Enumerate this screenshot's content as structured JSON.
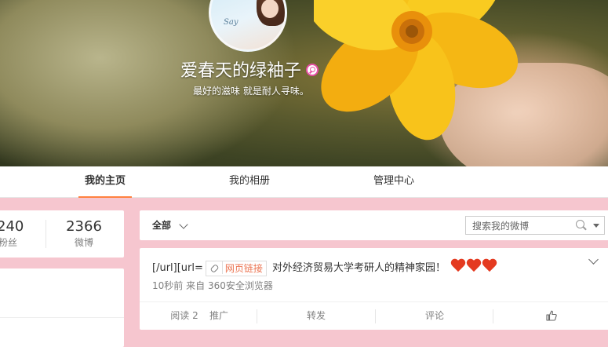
{
  "profile": {
    "nickname": "爱春天的绿袖子",
    "motto": "最好的滋味 就是耐人寻味。",
    "avatar_text": "Say"
  },
  "tabs": [
    {
      "label": "我的主页",
      "active": true
    },
    {
      "label": "我的相册",
      "active": false
    },
    {
      "label": "管理中心",
      "active": false
    }
  ],
  "counts": {
    "fans_num": "240",
    "fans_label": "粉丝",
    "posts_num": "2366",
    "posts_label": "微博"
  },
  "filter": {
    "all_label": "全部",
    "search_placeholder": "搜索我的微博"
  },
  "post": {
    "text_prefix": "[/url][url=",
    "link_label": "网页链接",
    "text_suffix": "对外经济贸易大学考研人的精神家园！",
    "time": "10秒前",
    "source_prefix": "来自",
    "source": "360安全浏览器",
    "reads": "阅读 2",
    "promote": "推广",
    "repost": "转发",
    "comment": "评论"
  },
  "colors": {
    "accent": "#ff8140",
    "link": "#eb7350",
    "page_bg": "#f6c6cf"
  }
}
